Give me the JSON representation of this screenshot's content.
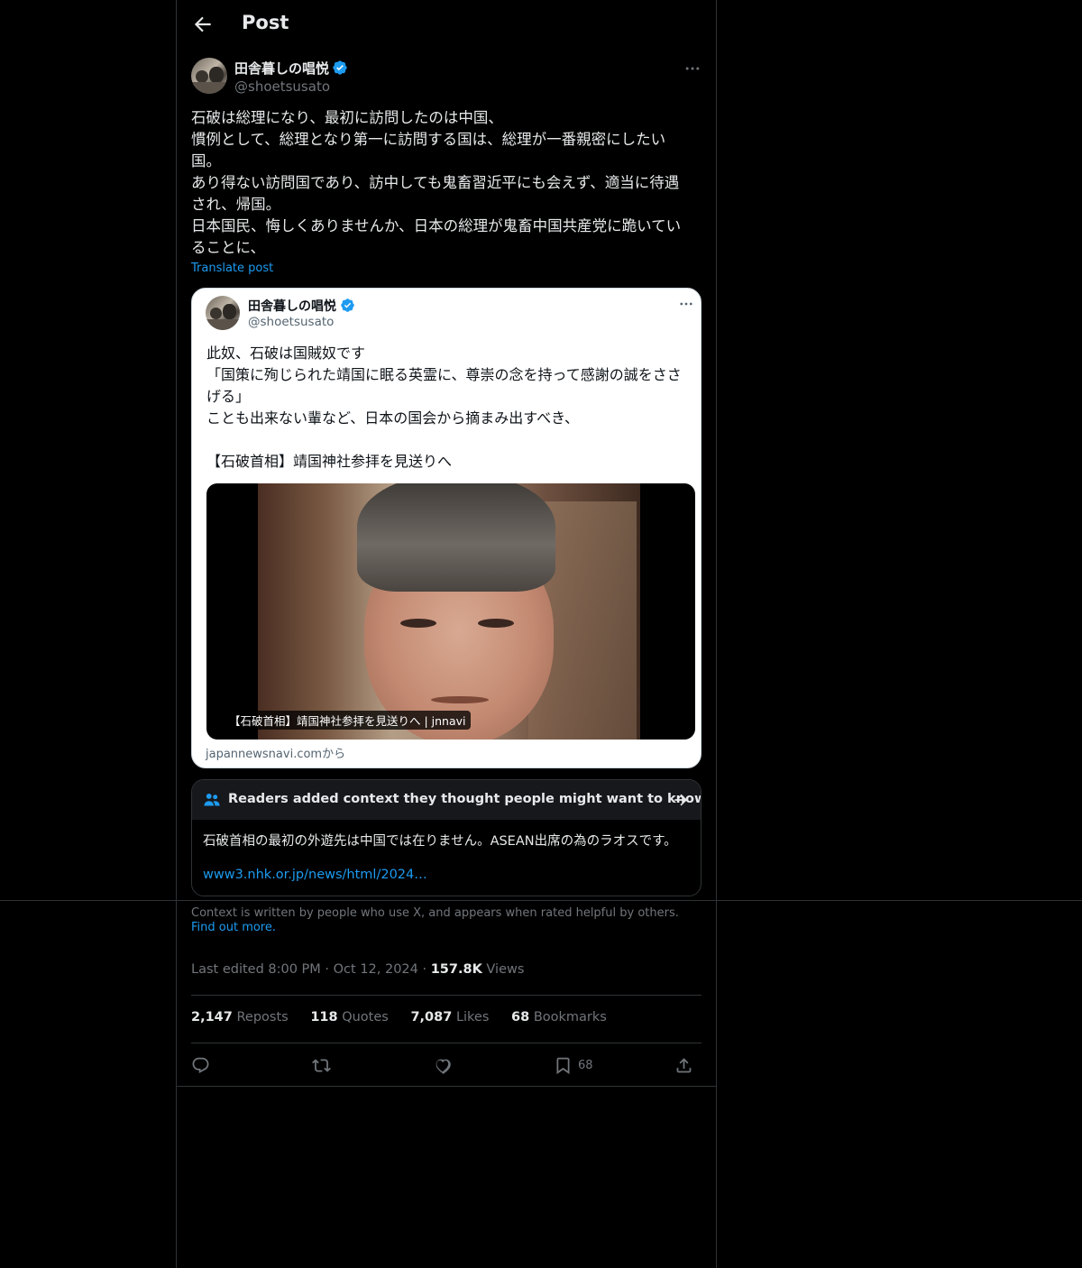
{
  "header": {
    "title": "Post"
  },
  "author": {
    "name": "田舎暮しの唱悦",
    "handle": "@shoetsusato"
  },
  "post": {
    "lines": [
      "石破は総理になり、最初に訪問したのは中国、",
      "慣例として、総理となり第一に訪問する国は、総理が一番親密にしたい",
      "国。",
      "あり得ない訪問国であり、訪中しても鬼畜習近平にも会えず、適当に待遇",
      "され、帰国。",
      "日本国民、悔しくありませんか、日本の総理が鬼畜中国共産党に跪いてい",
      "ることに、"
    ],
    "translate_label": "Translate post"
  },
  "quote": {
    "name": "田舎暮しの唱悦",
    "handle": "@shoetsusato",
    "lines": [
      "此奴、石破は国賊奴です",
      "「国策に殉じられた靖国に眠る英霊に、尊崇の念を持って感謝の誠をささ",
      "げる」",
      "ことも出来ない輩など、日本の国会から摘まみ出すべき、",
      "",
      "【石破首相】靖国神社参拝を見送りへ"
    ],
    "media_caption": "【石破首相】靖国神社参拝を見送りへ | jnnavi",
    "source": "japannewsnavi.comから"
  },
  "community_note": {
    "title": "Readers added context they thought people might want to know",
    "text": "石破首相の最初の外遊先は中国では在りません。ASEAN出席の為のラオスです。",
    "link": "www3.nhk.or.jp/news/html/2024…"
  },
  "context_footer": {
    "text": "Context is written by people who use X, and appears when rated helpful by others.",
    "link": "Find out more."
  },
  "meta": {
    "edited": "Last edited 8:00 PM · Oct 12, 2024 · ",
    "views_count": "157.8K",
    "views_label": " Views"
  },
  "stats": {
    "reposts": "2,147",
    "reposts_label": "Reposts",
    "quotes": "118",
    "quotes_label": "Quotes",
    "likes": "7,087",
    "likes_label": "Likes",
    "bookmarks": "68",
    "bookmarks_label": "Bookmarks"
  },
  "actions": {
    "bookmark_count": "68"
  },
  "colors": {
    "accent": "#1d9bf0",
    "background": "#000000",
    "text": "#e7e9ea",
    "muted": "#71767b",
    "border": "#2f3336"
  }
}
